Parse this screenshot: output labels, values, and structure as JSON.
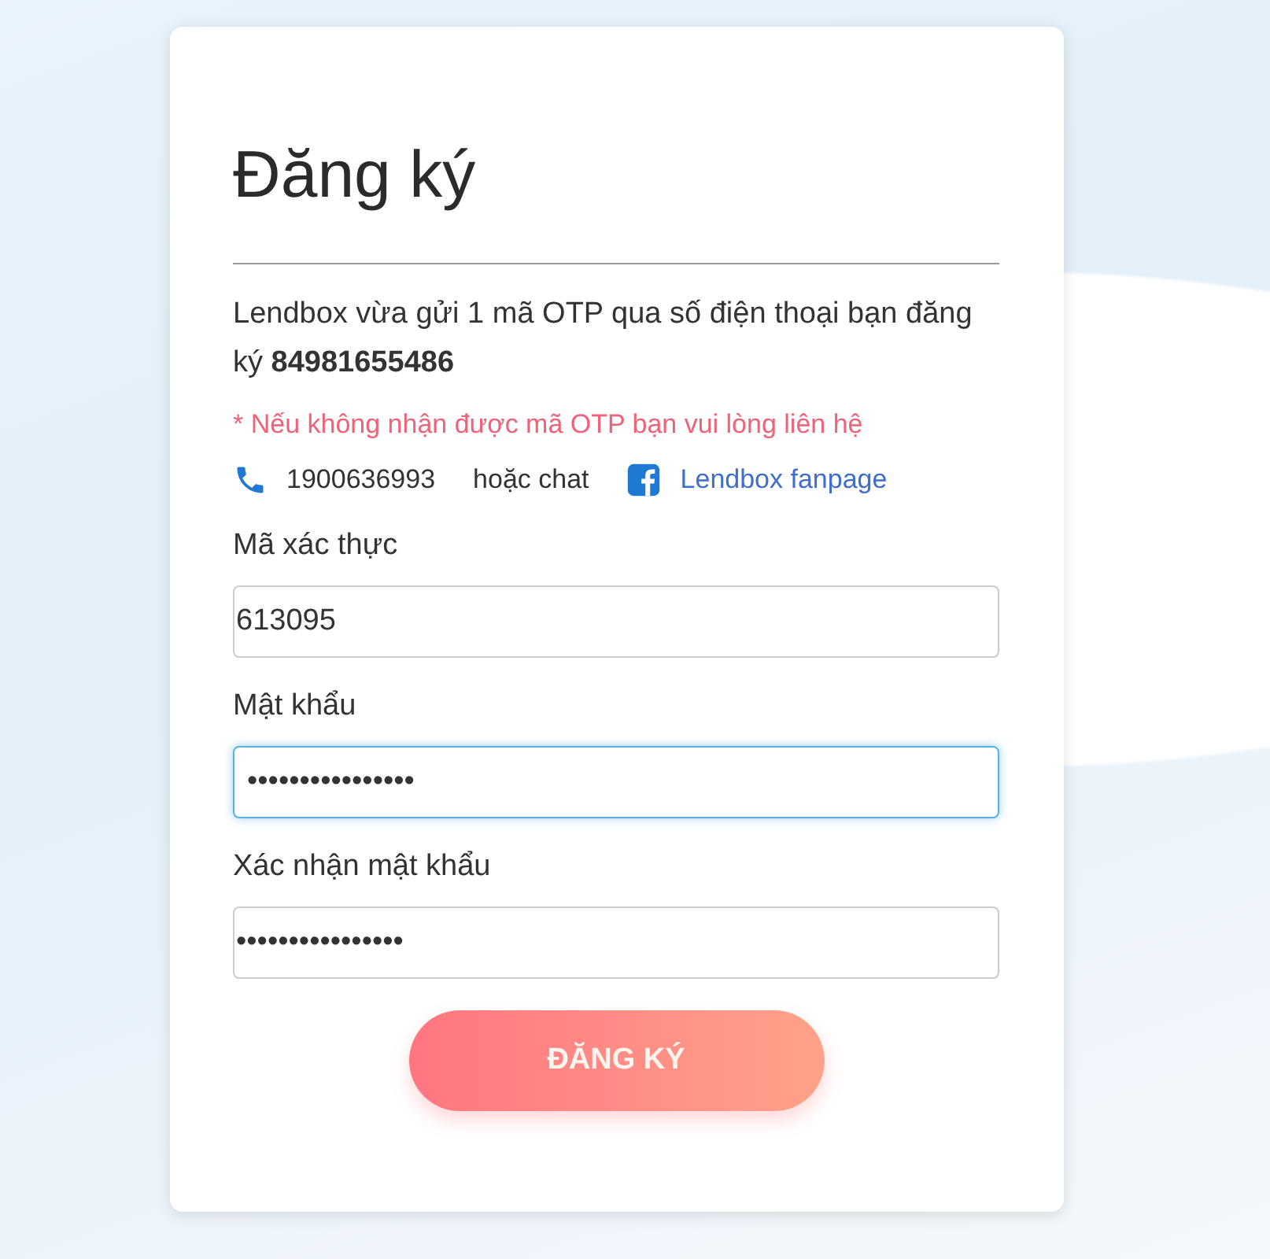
{
  "title": "Đăng ký",
  "message": "Lendbox vừa gửi 1 mã OTP qua số điện thoại bạn đăng ký **84981655486**",
  "notice": "* Nếu không nhận được mã OTP bạn vui lòng liên hệ",
  "contact": {
    "phone": "1900636993",
    "or_text": "hoặc chat",
    "fanpage_link": "Lendbox fanpage"
  },
  "fields": [
    {
      "label": "Mã xác thực",
      "value": "613095",
      "focused": false
    },
    {
      "label": "Mật khẩu",
      "value": "••••••••••••••••",
      "focused": true
    },
    {
      "label": "Xác nhận mật khẩu",
      "value": "••••••••••••••••",
      "focused": false
    }
  ],
  "submit_button": "ĐĂNG KÝ"
}
